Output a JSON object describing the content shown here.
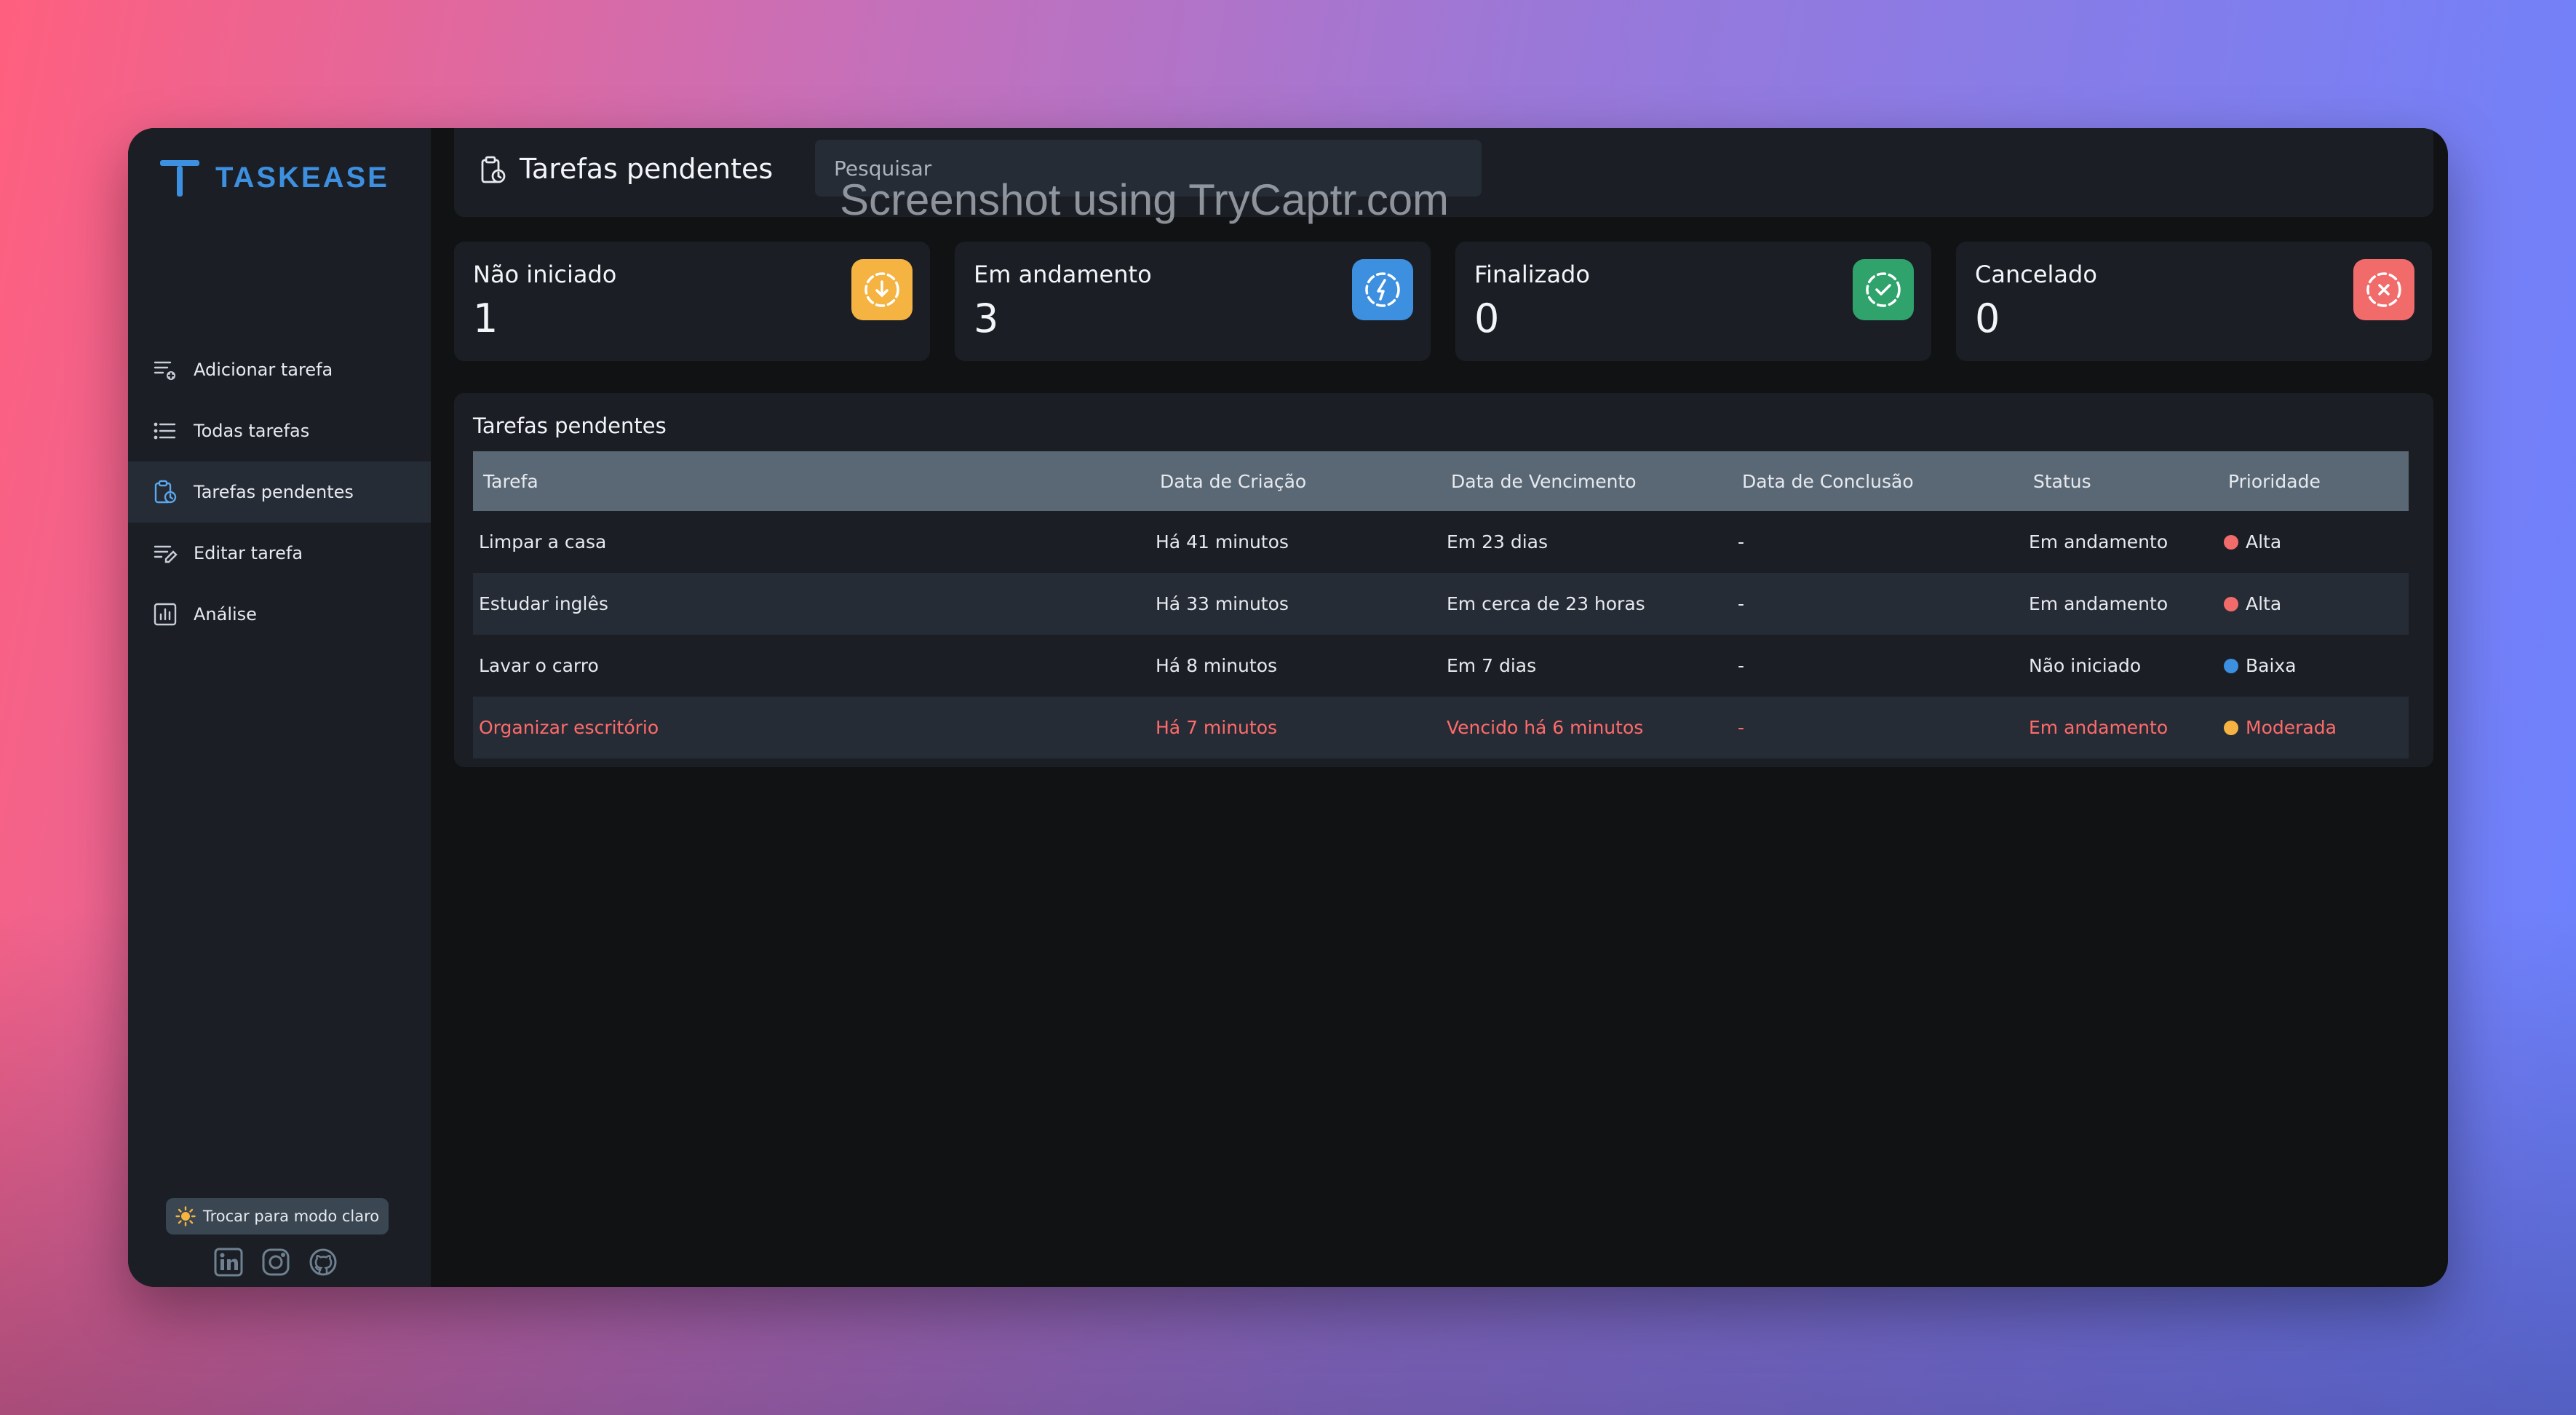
{
  "watermark": "Screenshot using TryCaptr.com",
  "app": {
    "name": "TASKEASE",
    "accent": "#3d8fe0"
  },
  "sidebar": {
    "items": [
      {
        "label": "Adicionar tarefa",
        "icon": "add-task-icon"
      },
      {
        "label": "Todas tarefas",
        "icon": "list-icon"
      },
      {
        "label": "Tarefas pendentes",
        "icon": "clipboard-clock-icon",
        "active": true
      },
      {
        "label": "Editar tarefa",
        "icon": "edit-list-icon"
      },
      {
        "label": "Análise",
        "icon": "analytics-icon"
      }
    ],
    "theme_toggle": "Trocar para modo claro",
    "socials": [
      "linkedin-icon",
      "instagram-icon",
      "github-icon"
    ]
  },
  "header": {
    "title": "Tarefas pendentes",
    "search_placeholder": "Pesquisar"
  },
  "stats": [
    {
      "label": "Não iniciado",
      "count": "1",
      "color": "#f5b342",
      "icon": "not-started-icon"
    },
    {
      "label": "Em andamento",
      "count": "3",
      "color": "#3d8fe0",
      "icon": "in-progress-icon"
    },
    {
      "label": "Finalizado",
      "count": "0",
      "color": "#2fa36b",
      "icon": "completed-icon"
    },
    {
      "label": "Cancelado",
      "count": "0",
      "color": "#f26b6b",
      "icon": "cancelled-icon"
    }
  ],
  "table": {
    "title": "Tarefas pendentes",
    "columns": [
      "Tarefa",
      "Data de Criação",
      "Data de Vencimento",
      "Data de Conclusão",
      "Status",
      "Prioridade"
    ],
    "rows": [
      {
        "task": "Limpar a casa",
        "created": "Há 41 minutos",
        "due": "Em 23 dias",
        "completed": "-",
        "status": "Em andamento",
        "priority": "Alta",
        "priority_color": "#f26b6b",
        "overdue": false
      },
      {
        "task": "Estudar inglês",
        "created": "Há 33 minutos",
        "due": "Em cerca de 23 horas",
        "completed": "-",
        "status": "Em andamento",
        "priority": "Alta",
        "priority_color": "#f26b6b",
        "overdue": false
      },
      {
        "task": "Lavar o carro",
        "created": "Há 8 minutos",
        "due": "Em 7 dias",
        "completed": "-",
        "status": "Não iniciado",
        "priority": "Baixa",
        "priority_color": "#3d8fe0",
        "overdue": false
      },
      {
        "task": "Organizar escritório",
        "created": "Há 7 minutos",
        "due": "Vencido há 6 minutos",
        "completed": "-",
        "status": "Em andamento",
        "priority": "Moderada",
        "priority_color": "#f5b342",
        "overdue": true
      }
    ]
  }
}
